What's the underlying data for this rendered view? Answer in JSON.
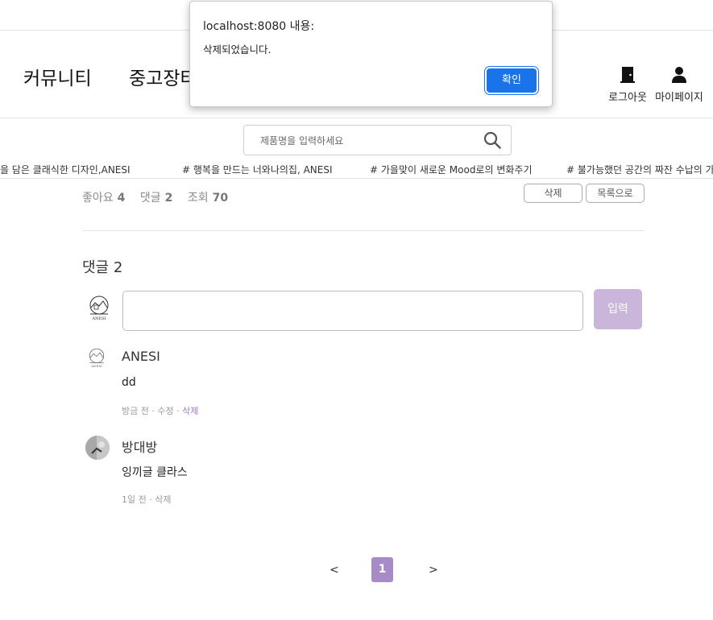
{
  "header": {
    "nav": {
      "community": "커뮤니티",
      "market": "중고장터"
    },
    "logout_label": "로그아웃",
    "mypage_label": "마이페이지"
  },
  "search": {
    "placeholder": "제품명을 입력하세요"
  },
  "ticker": [
    "# 자연을 담은 클래식한 디자인,ANESI",
    "# 행복을 만드는 너와나의집, ANESI",
    "# 가을맞이 새로운 Mood로의 변화주기",
    "# 불가능했던 공간의 짜잔 수납의 가능"
  ],
  "post": {
    "likes_label": "좋아요",
    "likes": "4",
    "comments_label": "댓글",
    "comments": "2",
    "views_label": "조회",
    "views": "70",
    "delete_label": "삭제",
    "list_label": "목록으로"
  },
  "comment_section": {
    "title": "댓글 2",
    "submit_label": "입력",
    "input_value": "",
    "items": [
      {
        "author": "ANESI",
        "body": "dd",
        "time": "방금 전",
        "edit": "수정",
        "delete": "삭제"
      },
      {
        "author": "방대방",
        "body": "잉끼글 클라스",
        "time": "1일 전",
        "delete": "삭제"
      }
    ]
  },
  "pagination": {
    "prev": "<",
    "current": "1",
    "next": ">"
  },
  "dialog": {
    "title": "localhost:8080 내용:",
    "message": "삭제되었습니다.",
    "ok_label": "확인"
  },
  "colors": {
    "accent_purple": "#a78bc7",
    "submit_purple": "#c9b6da",
    "dialog_blue": "#1a73e8"
  },
  "icons": {
    "logout": "door-icon",
    "mypage": "person-icon",
    "search": "search-icon"
  }
}
